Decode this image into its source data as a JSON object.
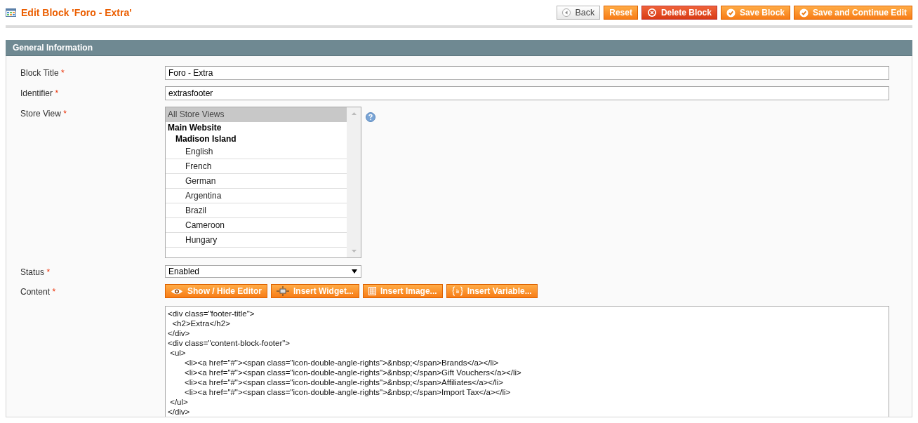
{
  "page_title": "Edit Block 'Foro - Extra'",
  "actions": [
    {
      "label": "Back",
      "kind": "back"
    },
    {
      "label": "Reset",
      "kind": "plain"
    },
    {
      "label": "Delete Block",
      "kind": "delete"
    },
    {
      "label": "Save Block",
      "kind": "save"
    },
    {
      "label": "Save and Continue Edit",
      "kind": "save"
    }
  ],
  "section": {
    "title": "General Information",
    "fields": [
      {
        "label": "Block Title",
        "mark": "*",
        "kind": "text",
        "value": "Foro - Extra"
      },
      {
        "label": "Identifier",
        "mark": "*",
        "kind": "text",
        "value": "extrasfooter"
      },
      {
        "label": "Store View",
        "mark": "*",
        "kind": "multiselect",
        "options": [
          {
            "label": "All Store Views",
            "selected": true
          },
          {
            "label": "Main Website",
            "kind": "group",
            "children": [
              {
                "label": "Madison Island",
                "kind": "group",
                "children": [
                  {
                    "label": "English",
                    "selected": false
                  },
                  {
                    "label": "French",
                    "selected": false
                  },
                  {
                    "label": "German",
                    "selected": false
                  },
                  {
                    "label": "Argentina",
                    "selected": false
                  },
                  {
                    "label": "Brazil",
                    "selected": false
                  },
                  {
                    "label": "Cameroon",
                    "selected": false
                  },
                  {
                    "label": "Hungary",
                    "selected": false
                  }
                ]
              }
            ]
          }
        ]
      },
      {
        "label": "Status",
        "mark": "*",
        "kind": "select",
        "value": "Enabled"
      },
      {
        "label": "Content",
        "mark": "*",
        "kind": "editor",
        "buttons": [
          {
            "label": "Show / Hide Editor",
            "kind": "toggle"
          },
          {
            "label": "Insert Widget...",
            "kind": "widget"
          },
          {
            "label": "Insert Image...",
            "kind": "image"
          },
          {
            "label": "Insert Variable...",
            "kind": "variable"
          }
        ],
        "value": "<div class=\"footer-title\">\n  <h2>Extra</h2>\n</div>\n<div class=\"content-block-footer\">\n <ul>\n\t<li><a href=\"#\"><span class=\"icon-double-angle-rights\">&nbsp;</span>Brands</a></li>\n\t<li><a href=\"#\"><span class=\"icon-double-angle-rights\">&nbsp;</span>Gift Vouchers</a></li>\n\t<li><a href=\"#\"><span class=\"icon-double-angle-rights\">&nbsp;</span>Affiliates</a></li>\n\t<li><a href=\"#\"><span class=\"icon-double-angle-rights\">&nbsp;</span>Import Tax</a></li>\n </ul>\n</div>"
      }
    ]
  }
}
